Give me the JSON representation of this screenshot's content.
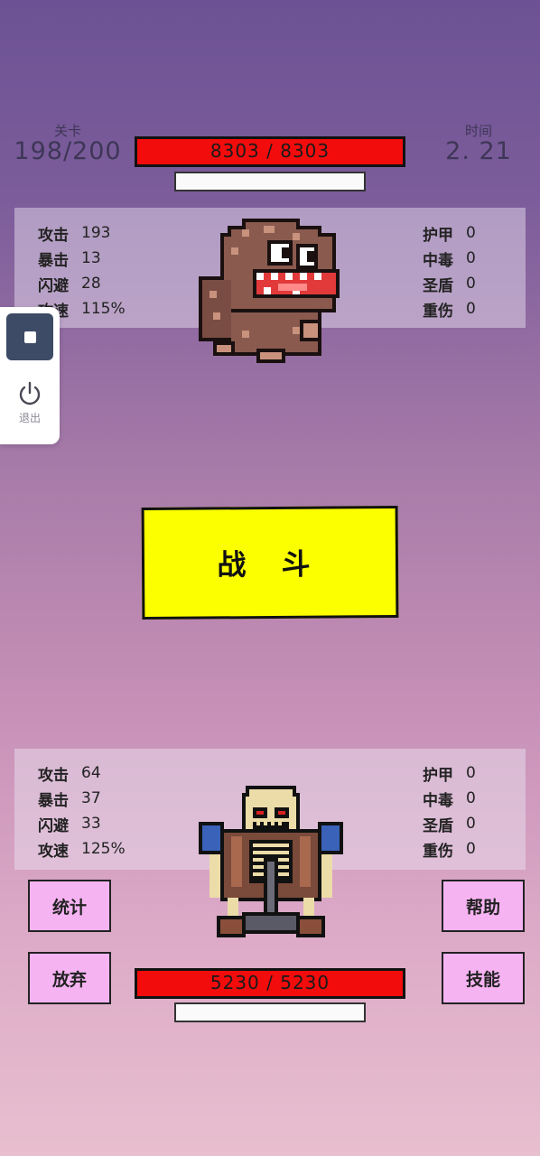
{
  "header": {
    "level_label": "关卡",
    "level_value": "198/200",
    "time_label": "时间",
    "time_value": "2. 21"
  },
  "enemy": {
    "hp_text": "8303 / 8303",
    "hp_fraction": 1.0,
    "stats_left": [
      {
        "label": "攻击",
        "value": "193"
      },
      {
        "label": "暴击",
        "value": "13"
      },
      {
        "label": "闪避",
        "value": "28"
      },
      {
        "label": "攻速",
        "value": "115%"
      }
    ],
    "stats_right": [
      {
        "label": "护甲",
        "value": "0"
      },
      {
        "label": "中毒",
        "value": "0"
      },
      {
        "label": "圣盾",
        "value": "0"
      },
      {
        "label": "重伤",
        "value": "0"
      }
    ]
  },
  "player": {
    "hp_text": "5230 / 5230",
    "hp_fraction": 1.0,
    "stats_left": [
      {
        "label": "攻击",
        "value": "64"
      },
      {
        "label": "暴击",
        "value": "37"
      },
      {
        "label": "闪避",
        "value": "33"
      },
      {
        "label": "攻速",
        "value": "125%"
      }
    ],
    "stats_right": [
      {
        "label": "护甲",
        "value": "0"
      },
      {
        "label": "中毒",
        "value": "0"
      },
      {
        "label": "圣盾",
        "value": "0"
      },
      {
        "label": "重伤",
        "value": "0"
      }
    ]
  },
  "fight_button": "战 斗",
  "buttons": {
    "stats": "统计",
    "help": "帮助",
    "give_up": "放弃",
    "skills": "技能"
  },
  "float_menu": {
    "exit_label": "退出"
  },
  "icons": {
    "stop": "stop-icon",
    "power": "power-icon"
  },
  "colors": {
    "hp_bar": "#f20c0c",
    "fight_button": "#fbff00",
    "action_button": "#f6b3f2"
  }
}
